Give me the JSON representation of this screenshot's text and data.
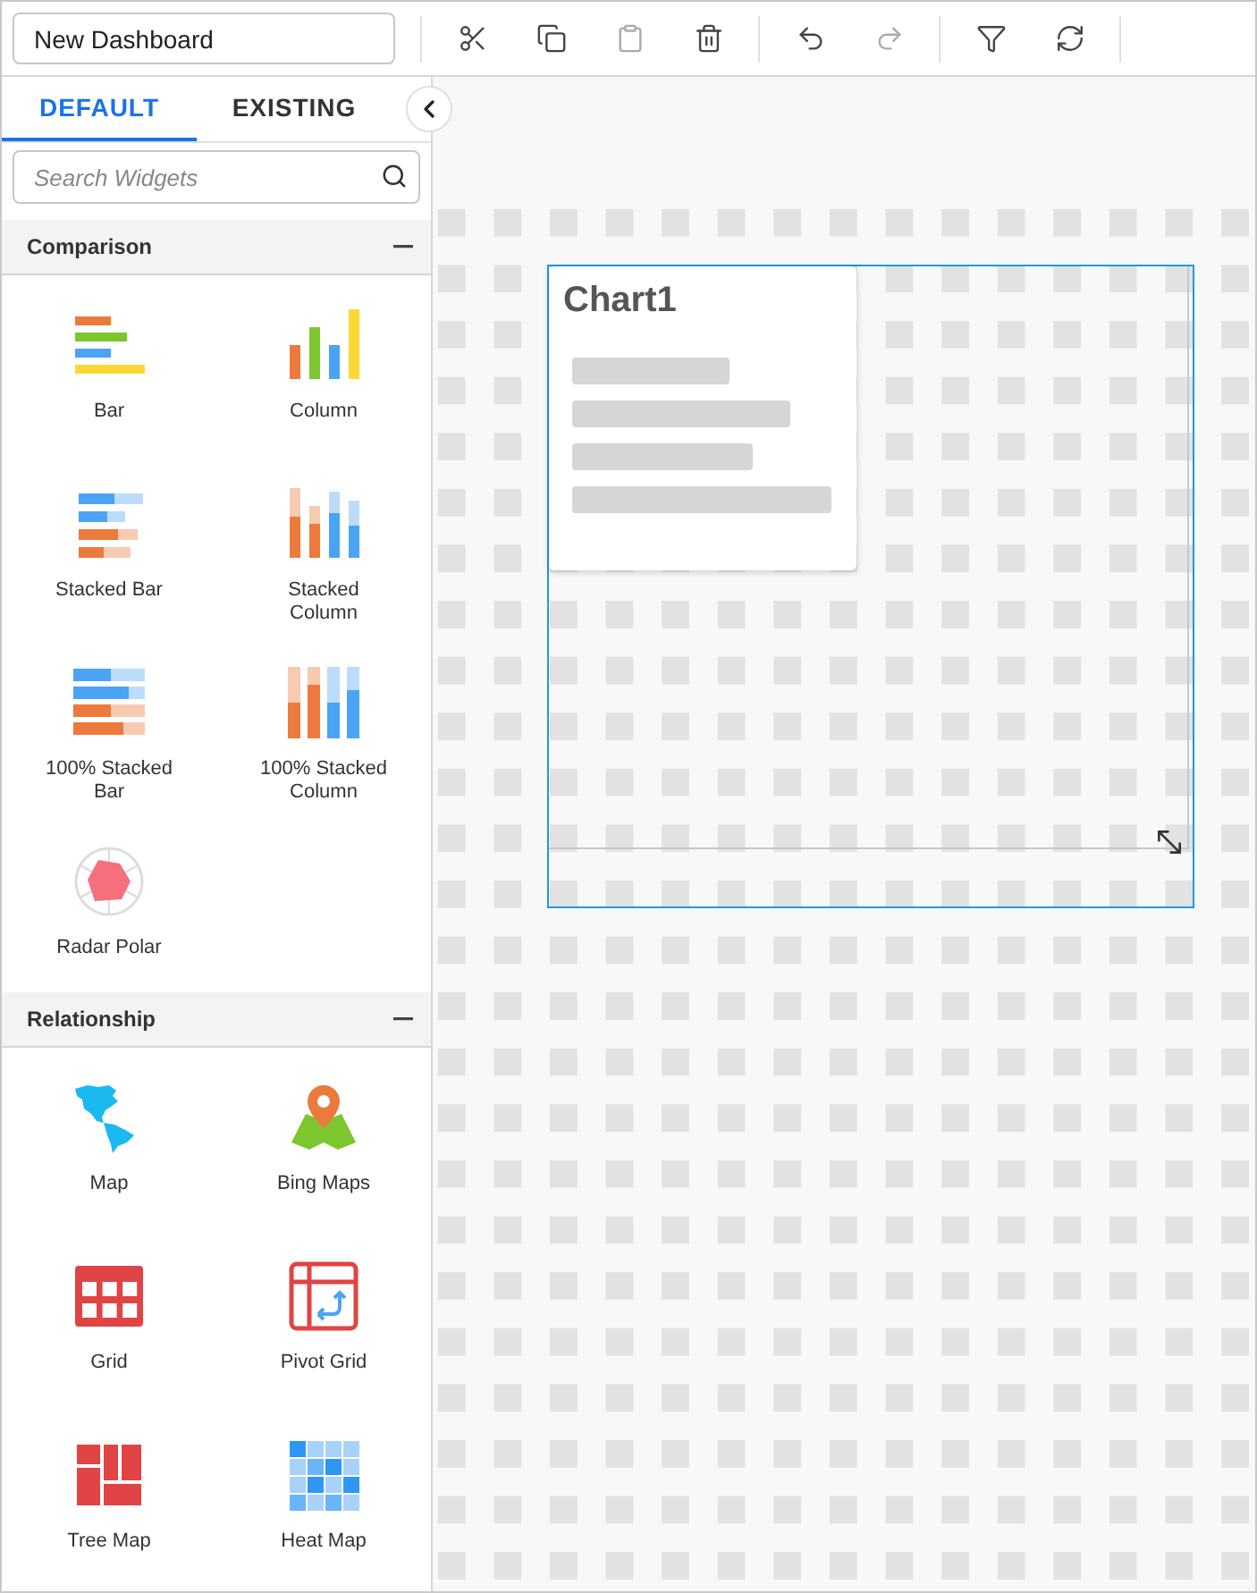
{
  "toolbar": {
    "dashboard_name": "New Dashboard",
    "tools": [
      {
        "kind": "cut",
        "disabled": false
      },
      {
        "kind": "copy",
        "disabled": false
      },
      {
        "kind": "paste",
        "disabled": true
      },
      {
        "kind": "delete",
        "disabled": false
      },
      {
        "kind": "undo",
        "disabled": false
      },
      {
        "kind": "redo",
        "disabled": true
      },
      {
        "kind": "filter",
        "disabled": false
      },
      {
        "kind": "refresh",
        "disabled": false
      }
    ]
  },
  "sidebar": {
    "tabs": [
      {
        "label": "DEFAULT",
        "selected": true
      },
      {
        "label": "EXISTING",
        "selected": false
      }
    ],
    "search": {
      "placeholder": "Search Widgets"
    },
    "groups": [
      {
        "name": "Comparison",
        "expanded": true,
        "widgets": [
          {
            "label": "Bar",
            "kind": "bar"
          },
          {
            "label": "Column",
            "kind": "column"
          },
          {
            "label": "Stacked Bar",
            "kind": "stacked-bar"
          },
          {
            "label": "Stacked Column",
            "kind": "stacked-column"
          },
          {
            "label": "100% Stacked Bar",
            "kind": "full-stacked-bar"
          },
          {
            "label": "100% Stacked Column",
            "kind": "full-stacked-column"
          },
          {
            "label": "Radar Polar",
            "kind": "radar"
          }
        ]
      },
      {
        "name": "Relationship",
        "expanded": true,
        "widgets": [
          {
            "label": "Map",
            "kind": "map"
          },
          {
            "label": "Bing Maps",
            "kind": "bing-maps"
          },
          {
            "label": "Grid",
            "kind": "grid"
          },
          {
            "label": "Pivot Grid",
            "kind": "pivot-grid"
          },
          {
            "label": "Tree Map",
            "kind": "tree-map"
          },
          {
            "label": "Heat Map",
            "kind": "heat-map"
          }
        ]
      }
    ]
  },
  "canvas": {
    "widgets": [
      {
        "title": "Chart1",
        "selected": true
      }
    ]
  }
}
